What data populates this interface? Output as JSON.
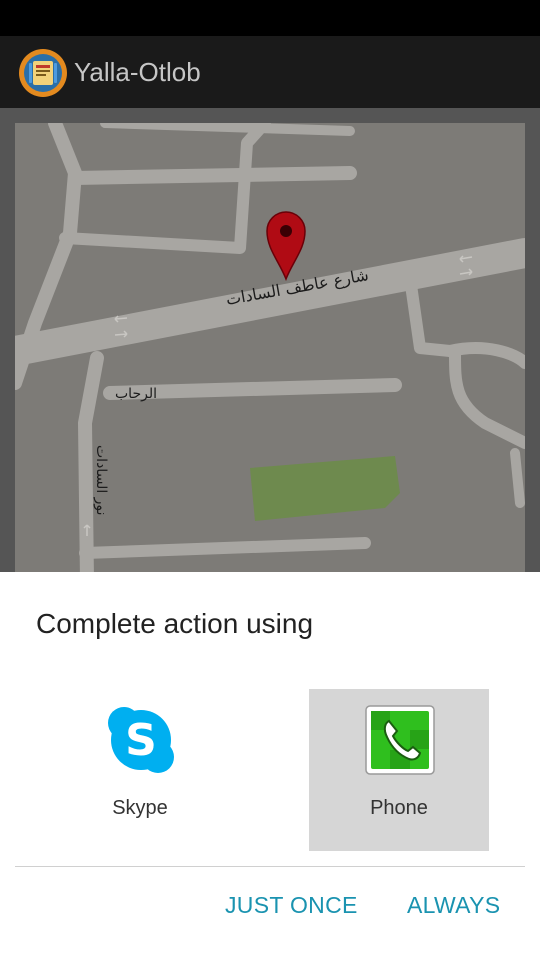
{
  "action_bar": {
    "title": "Yalla-Otlob"
  },
  "map": {
    "street_main": "شارع عاطف السادات",
    "street_rehab": "الرحاب",
    "street_vertical": "نور السادات"
  },
  "dialog": {
    "title": "Complete action using",
    "options": [
      {
        "label": "Skype",
        "icon": "skype-icon",
        "selected": false
      },
      {
        "label": "Phone",
        "icon": "phone-app-icon",
        "selected": true
      }
    ],
    "buttons": {
      "just_once": "JUST ONCE",
      "always": "ALWAYS"
    }
  },
  "colors": {
    "accent": "#1a93b0",
    "skype": "#00aff0",
    "phone_green": "#2fbf1e",
    "marker": "#b00b14",
    "selection": "#d6d6d6"
  }
}
